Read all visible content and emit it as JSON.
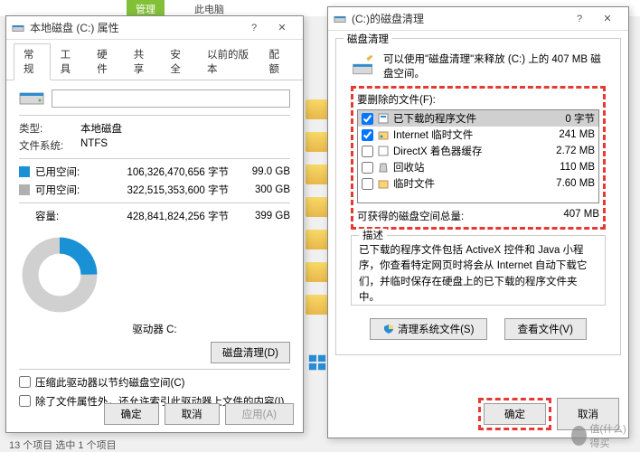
{
  "background": {
    "tab1": "管理",
    "tab2": "此电脑",
    "status": "13 个项目    选中 1 个项目"
  },
  "prop": {
    "title": "本地磁盘 (C:) 属性",
    "tabs": [
      "常规",
      "工具",
      "硬件",
      "共享",
      "安全",
      "以前的版本",
      "配额"
    ],
    "type_label": "类型:",
    "type_value": "本地磁盘",
    "fs_label": "文件系统:",
    "fs_value": "NTFS",
    "used_label": "已用空间:",
    "used_bytes": "106,326,470,656 字节",
    "used_gb": "99.0 GB",
    "free_label": "可用空间:",
    "free_bytes": "322,515,353,600 字节",
    "free_gb": "300 GB",
    "cap_label": "容量:",
    "cap_bytes": "428,841,824,256 字节",
    "cap_gb": "399 GB",
    "drive_label": "驱动器 C:",
    "cleanup_btn": "磁盘清理(D)",
    "chk1": "压缩此驱动器以节约磁盘空间(C)",
    "chk2": "除了文件属性外，还允许索引此驱动器上文件的内容(I)",
    "ok": "确定",
    "cancel": "取消",
    "apply": "应用(A)"
  },
  "clean": {
    "title": "(C:)的磁盘清理",
    "group_title": "磁盘清理",
    "intro": "可以使用\"磁盘清理\"来释放  (C:) 上的 407 MB 磁盘空间。",
    "files_label": "要删除的文件(F):",
    "files": [
      {
        "name": "已下载的程序文件",
        "size": "0 字节",
        "checked": true,
        "sel": true
      },
      {
        "name": "Internet 临时文件",
        "size": "241 MB",
        "checked": true,
        "sel": false
      },
      {
        "name": "DirectX 着色器缓存",
        "size": "2.72 MB",
        "checked": false,
        "sel": false
      },
      {
        "name": "回收站",
        "size": "110 MB",
        "checked": false,
        "sel": false
      },
      {
        "name": "临时文件",
        "size": "7.60 MB",
        "checked": false,
        "sel": false
      }
    ],
    "gain_label": "可获得的磁盘空间总量:",
    "gain_value": "407 MB",
    "desc_title": "描述",
    "desc_text": "已下载的程序文件包括 ActiveX 控件和 Java 小程序，你查看特定网页时将会从 Internet 自动下载它们，并临时保存在硬盘上的已下载的程序文件夹中。",
    "sys_btn": "清理系统文件(S)",
    "view_btn": "查看文件(V)",
    "ok": "确定",
    "cancel": "取消"
  },
  "watermark": "值(什么)得买"
}
